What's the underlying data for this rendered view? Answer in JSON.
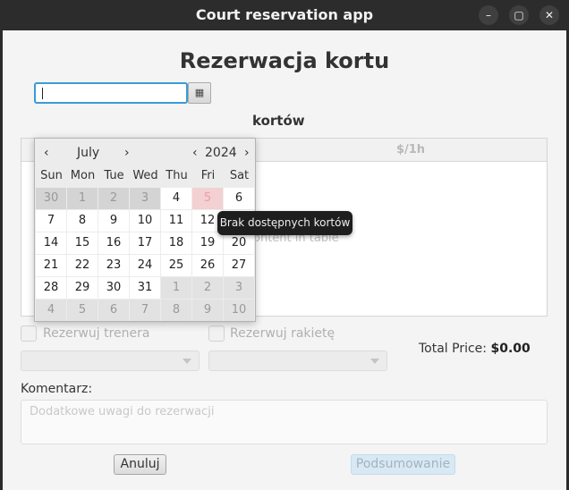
{
  "window": {
    "title": "Court reservation app"
  },
  "heading": "Rezerwacja kortu",
  "date_field": {
    "value": ""
  },
  "section_label": "kortów",
  "table": {
    "column_price": "$/1h",
    "placeholder": "ontent in table"
  },
  "options": {
    "trainer_label": "Rezerwuj trenera",
    "racket_label": "Rezerwuj rakietę"
  },
  "total": {
    "label": "Total Price:",
    "value": "$0.00"
  },
  "comment": {
    "label": "Komentarz:",
    "placeholder": "Dodatkowe uwagi do rezerwacji"
  },
  "buttons": {
    "cancel": "Anuluj",
    "summary": "Podsumowanie"
  },
  "calendar": {
    "month": "July",
    "year": "2024",
    "weekdays": [
      "Sun",
      "Mon",
      "Tue",
      "Wed",
      "Thu",
      "Fri",
      "Sat"
    ],
    "weeks": [
      [
        "30",
        "1",
        "2",
        "3",
        "4",
        "5",
        "6"
      ],
      [
        "7",
        "8",
        "9",
        "10",
        "11",
        "12",
        "13"
      ],
      [
        "14",
        "15",
        "16",
        "17",
        "18",
        "19",
        "20"
      ],
      [
        "21",
        "22",
        "23",
        "24",
        "25",
        "26",
        "27"
      ],
      [
        "28",
        "29",
        "30",
        "31",
        "1",
        "2",
        "3"
      ],
      [
        "4",
        "5",
        "6",
        "7",
        "8",
        "9",
        "10"
      ]
    ],
    "disabled_days": [
      "30",
      "1",
      "2",
      "3"
    ],
    "unavailable_day": "5",
    "tooltip": "Brak dostępnych kortów"
  },
  "colors": {
    "accent": "#3a9bd5",
    "unavailable": "#f3d0d2"
  }
}
